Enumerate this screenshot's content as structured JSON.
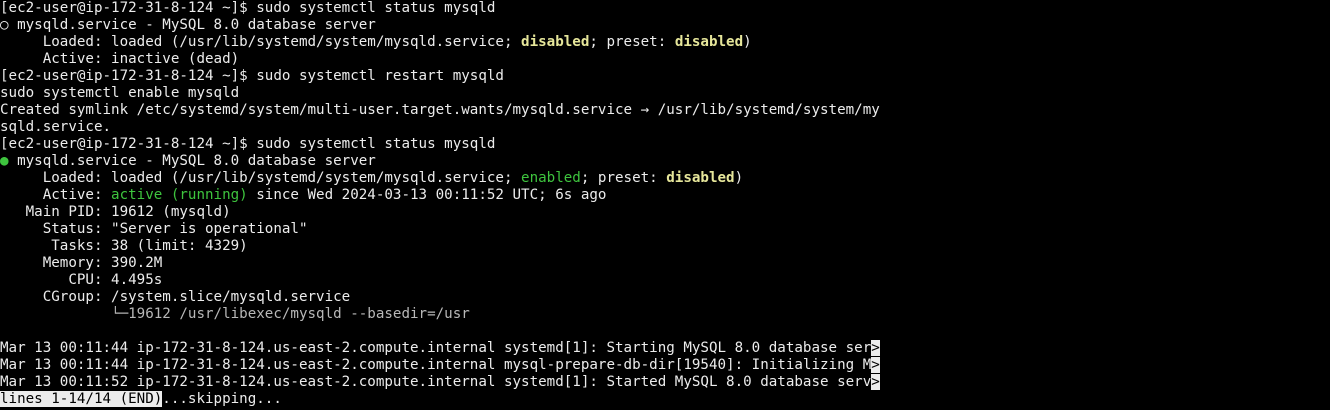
{
  "colors": {
    "background": "#000000",
    "foreground": "#ececec",
    "highlight_yellow": "#e6e69a",
    "status_green": "#3ec43e"
  },
  "lines": [
    [
      {
        "t": "[ec2-user@ip-172-31-8-124 ~]$ sudo systemctl status mysqld",
        "c": "default",
        "n": "prompt-command"
      }
    ],
    [
      {
        "t": "○ mysqld.service - MySQL 8.0 database server",
        "c": "default",
        "n": "unit-header"
      }
    ],
    [
      {
        "t": "     Loaded: loaded (/usr/lib/systemd/system/mysqld.service; ",
        "c": "default",
        "n": "loaded-field"
      },
      {
        "t": "disabled",
        "c": "yellow",
        "n": "enable-state"
      },
      {
        "t": "; preset: ",
        "c": "default",
        "n": "preset-label"
      },
      {
        "t": "disabled",
        "c": "yellow",
        "n": "preset-state"
      },
      {
        "t": ")",
        "c": "default",
        "n": "loaded-close"
      }
    ],
    [
      {
        "t": "     Active: inactive (dead)",
        "c": "default",
        "n": "active-field"
      }
    ],
    [
      {
        "t": "[ec2-user@ip-172-31-8-124 ~]$ sudo systemctl restart mysqld",
        "c": "default",
        "n": "prompt-command"
      }
    ],
    [
      {
        "t": "sudo systemctl enable mysqld",
        "c": "default",
        "n": "command-text"
      }
    ],
    [
      {
        "t": "Created symlink /etc/systemd/system/multi-user.target.wants/mysqld.service → /usr/lib/systemd/system/my",
        "c": "default",
        "n": "output-text"
      }
    ],
    [
      {
        "t": "sqld.service.",
        "c": "default",
        "n": "output-text"
      }
    ],
    [
      {
        "t": "[ec2-user@ip-172-31-8-124 ~]$ sudo systemctl status mysqld",
        "c": "default",
        "n": "prompt-command"
      }
    ],
    [
      {
        "t": "●",
        "c": "dot-green",
        "n": "active-dot-icon"
      },
      {
        "t": " mysqld.service - MySQL 8.0 database server",
        "c": "default",
        "n": "unit-header"
      }
    ],
    [
      {
        "t": "     Loaded: loaded (/usr/lib/systemd/system/mysqld.service; ",
        "c": "default",
        "n": "loaded-field"
      },
      {
        "t": "enabled",
        "c": "green",
        "n": "enable-state"
      },
      {
        "t": "; preset: ",
        "c": "default",
        "n": "preset-label"
      },
      {
        "t": "disabled",
        "c": "yellow",
        "n": "preset-state"
      },
      {
        "t": ")",
        "c": "default",
        "n": "loaded-close"
      }
    ],
    [
      {
        "t": "     Active: ",
        "c": "default",
        "n": "active-label"
      },
      {
        "t": "active (running)",
        "c": "green",
        "n": "active-state"
      },
      {
        "t": " since Wed 2024-03-13 00:11:52 UTC; 6s ago",
        "c": "default",
        "n": "active-since"
      }
    ],
    [
      {
        "t": "   Main PID: 19612 (mysqld)",
        "c": "default",
        "n": "main-pid-field"
      }
    ],
    [
      {
        "t": "     Status: \"Server is operational\"",
        "c": "default",
        "n": "status-field"
      }
    ],
    [
      {
        "t": "      Tasks: 38 (limit: 4329)",
        "c": "default",
        "n": "tasks-field"
      }
    ],
    [
      {
        "t": "     Memory: 390.2M",
        "c": "default",
        "n": "memory-field"
      }
    ],
    [
      {
        "t": "        CPU: 4.495s",
        "c": "default",
        "n": "cpu-field"
      }
    ],
    [
      {
        "t": "     CGroup: /system.slice/mysqld.service",
        "c": "default",
        "n": "cgroup-field"
      }
    ],
    [
      {
        "t": "             └─19612 /usr/libexec/mysqld --basedir=/usr",
        "c": "dim",
        "n": "cgroup-process"
      }
    ],
    [
      {
        "t": "",
        "c": "default",
        "n": "blank-line"
      }
    ],
    [
      {
        "t": "Mar 13 00:11:44 ip-172-31-8-124.us-east-2.compute.internal systemd[1]: Starting MySQL 8.0 database ser",
        "c": "default",
        "n": "log-entry"
      },
      {
        "t": ">",
        "c": "trunc",
        "n": "truncation-marker"
      }
    ],
    [
      {
        "t": "Mar 13 00:11:44 ip-172-31-8-124.us-east-2.compute.internal mysql-prepare-db-dir[19540]: Initializing M",
        "c": "default",
        "n": "log-entry"
      },
      {
        "t": ">",
        "c": "trunc",
        "n": "truncation-marker"
      }
    ],
    [
      {
        "t": "Mar 13 00:11:52 ip-172-31-8-124.us-east-2.compute.internal systemd[1]: Started MySQL 8.0 database serv",
        "c": "default",
        "n": "log-entry"
      },
      {
        "t": ">",
        "c": "trunc",
        "n": "truncation-marker"
      }
    ],
    [
      {
        "t": "lines 1-14/14 (END)",
        "c": "pager",
        "n": "pager-status"
      },
      {
        "t": "...skipping...",
        "c": "default",
        "n": "pager-skipping"
      }
    ]
  ]
}
